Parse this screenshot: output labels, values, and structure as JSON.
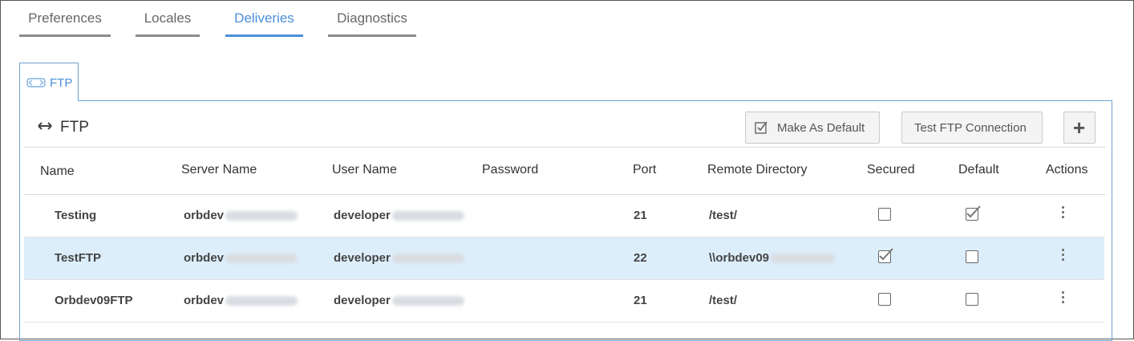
{
  "tabs": [
    {
      "label": "Preferences"
    },
    {
      "label": "Locales"
    },
    {
      "label": "Deliveries"
    },
    {
      "label": "Diagnostics"
    }
  ],
  "subtab": {
    "label": "FTP",
    "icon": "ftp-icon"
  },
  "panel": {
    "title": "FTP",
    "buttons": {
      "make_default": "Make As Default",
      "test_connection": "Test FTP Connection",
      "add": "+"
    }
  },
  "table": {
    "headers": [
      "Name",
      "Server Name",
      "User Name",
      "Password",
      "Port",
      "Remote Directory",
      "Secured",
      "Default",
      "Actions"
    ],
    "rows": [
      {
        "name": "Testing",
        "server": "orbdev",
        "user": "developer",
        "port": "21",
        "remote_dir": "/test/",
        "secured": false,
        "default": true,
        "selected": false
      },
      {
        "name": "TestFTP",
        "server": "orbdev",
        "user": "developer",
        "port": "22",
        "remote_dir": "\\\\orbdev09",
        "secured": true,
        "default": false,
        "selected": true
      },
      {
        "name": "Orbdev09FTP",
        "server": "orbdev",
        "user": "developer",
        "port": "21",
        "remote_dir": "/test/",
        "secured": false,
        "default": false,
        "selected": false
      }
    ]
  },
  "colors": {
    "accent": "#4a90d9",
    "selected_row": "#ddeefb"
  }
}
